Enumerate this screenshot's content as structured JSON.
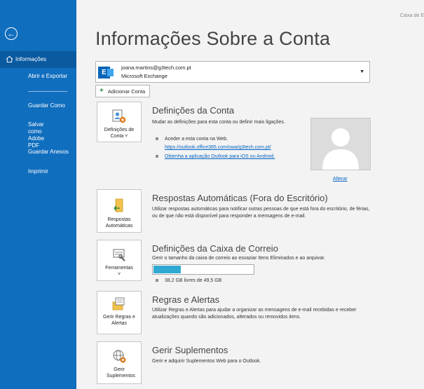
{
  "header": {
    "top_right": "Caixa de E",
    "page_title": "Informações Sobre a Conta"
  },
  "sidebar": {
    "items": [
      {
        "label": "Informações"
      },
      {
        "label": "Abrir e Exportar"
      },
      {
        "label": "Guardar Como"
      },
      {
        "label": "Salvar como Adobe PDF"
      },
      {
        "label": "Guardar Anexos"
      },
      {
        "label": "Imprimir"
      }
    ]
  },
  "account": {
    "email": "joana.martins@g3tech.com.pt",
    "type": "Microsoft Exchange",
    "add_label": "Adicionar Conta"
  },
  "account_settings": {
    "tile_label": "Definições de Conta ˅",
    "title": "Definições da Conta",
    "desc": "Mudar as definições para esta conta ou definir mais ligações.",
    "bullet1": "Aceder a esta conta na Web.",
    "link1": "https://outlook.office365.com/owa/g3tech.com.pt/",
    "link2": "Obtenha a aplicação Outlook para iOS ou Android.",
    "change_photo": "Alterar"
  },
  "auto_replies": {
    "tile_label": "Respostas Automáticas",
    "title": "Respostas Automáticas (Fora do Escritório)",
    "desc": "Utilizar respostas automáticas para notificar outras pessoas de que está fora do escritório, de férias, ou de que não está disponível para responder a mensagens de e-mail."
  },
  "mailbox": {
    "tile_label": "Ferramentas",
    "tile_sub": "˅",
    "title": "Definições da Caixa de Correio",
    "desc": "Gerir o tamanho da caixa de correio ao esvaziar Itens Eliminados e ao arquivar.",
    "usage_fraction": 0.27,
    "free_text": "38,2 GB livres de 49,5 GB"
  },
  "rules": {
    "tile_label": "Gerir Regras e Alertas",
    "title": "Regras e Alertas",
    "desc": "Utilizar Regras e Alertas para ajudar a organizar as mensagens de e-mail recebidas e receber atualizações quando são adicionados, alterados ou removidos itens."
  },
  "addins": {
    "tile_label": "Gerir Suplementos",
    "title": "Gerir Suplementos",
    "desc": "Gerir e adquirir Suplementos Web para o Outlook."
  },
  "colors": {
    "sidebar": "#106ebe",
    "sidebar_active": "#0a5aa0",
    "link": "#0563c1",
    "progress": "#2fa9d2"
  }
}
